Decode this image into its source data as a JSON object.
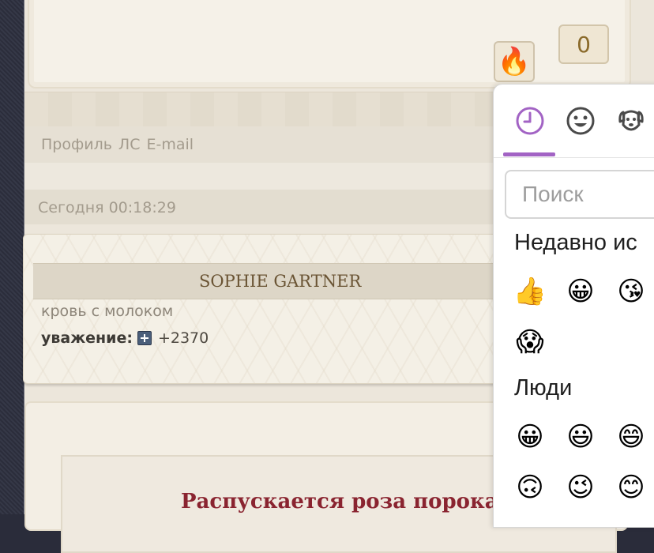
{
  "post": {
    "reaction_icon": "fire-icon",
    "reaction_emoji": "🔥",
    "reaction_count": "0"
  },
  "profile_links": [
    "Профиль",
    "ЛС",
    "E-mail"
  ],
  "post_date": "Сегодня 00:18:29",
  "author": {
    "name": "SOPHIE GARTNER",
    "status": "кровь с молоком",
    "respect_label": "уважение:",
    "respect_value": "+2370"
  },
  "next_post": {
    "heading": "Распускается роза порока..."
  },
  "emoji_picker": {
    "tabs": [
      {
        "name": "recent-tab",
        "icon": "clock-icon",
        "active": true
      },
      {
        "name": "smileys-tab",
        "icon": "smiley-icon",
        "active": false
      },
      {
        "name": "animals-tab",
        "icon": "dog-icon",
        "active": false
      }
    ],
    "search_placeholder": "Поиск",
    "recent_title": "Недавно ис",
    "recent": [
      "👍",
      "😀",
      "😘",
      "😱"
    ],
    "people_title": "Люди",
    "people": [
      "😀",
      "😃",
      "😄",
      "🙃",
      "😉",
      "😊"
    ],
    "accent_color": "#a263c4"
  }
}
